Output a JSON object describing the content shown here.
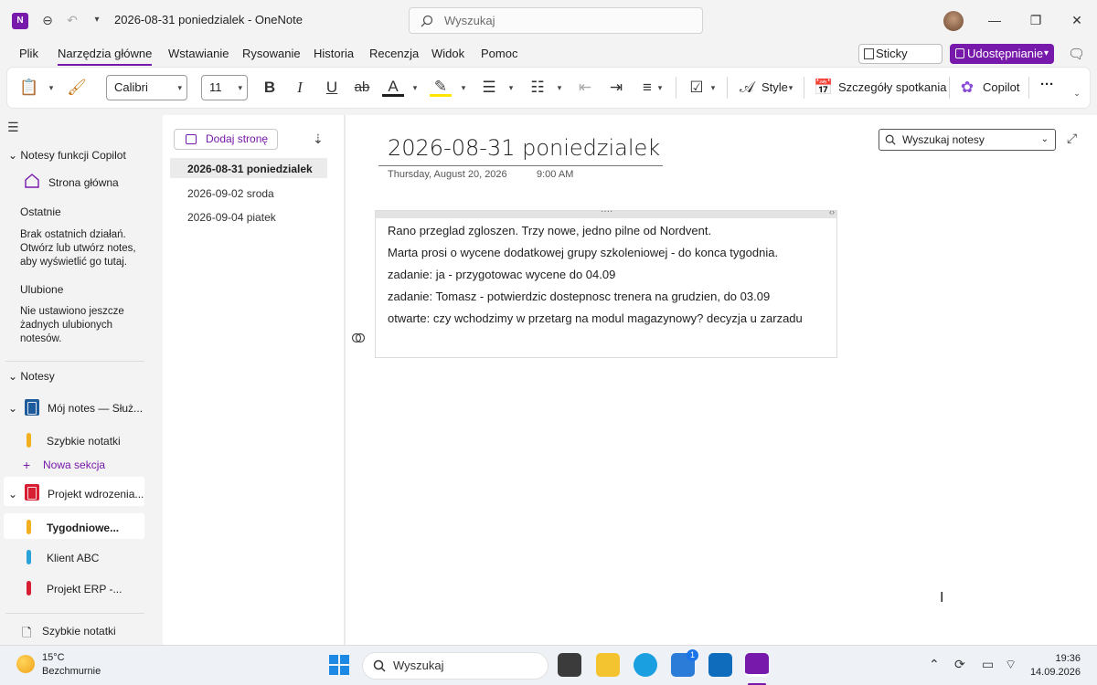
{
  "titlebar": {
    "app_icon": "onenote-icon",
    "doc_title": "2026-08-31 poniedzialek  -  OneNote",
    "search_placeholder": "Wyszukaj"
  },
  "menu": {
    "items": [
      "Plik",
      "Narzędzia główne",
      "Wstawianie",
      "Rysowanie",
      "Historia",
      "Recenzja",
      "Widok",
      "Pomoc"
    ],
    "active": "Narzędzia główne",
    "sticky_notes": "Sticky Notes",
    "share": "Udostępnianie"
  },
  "ribbon": {
    "font_name": "Calibri",
    "font_size": "11",
    "bold": "B",
    "italic": "I",
    "underline": "U",
    "strike": "ab",
    "font_color_letter": "A",
    "style": "Style",
    "meeting_details": "Szczegóły spotkania",
    "copilot": "Copilot",
    "more": "···",
    "colors": {
      "font_color": "#1f1f1f",
      "highlight": "#ffe600",
      "accent": "#7719aa"
    }
  },
  "left_nav": {
    "copilot_notebooks": "Notesy funkcji Copilot",
    "home": "Strona główna",
    "recent_heading": "Ostatnie",
    "recent_empty": "Brak ostatnich działań. Otwórz lub utwórz notes, aby wyświetlić go tutaj.",
    "favorites_heading": "Ulubione",
    "favorites_empty": "Nie ustawiono jeszcze żadnych ulubionych notesów.",
    "notebooks_heading": "Notesy",
    "notebooks": [
      {
        "name": "Mój notes — Służ...",
        "color": "#1e5b9c",
        "sections": [
          {
            "name": "Szybkie notatki",
            "color": "#f2b01e"
          }
        ],
        "add_section": "Nowa sekcja"
      },
      {
        "name": "Projekt wdrozenia...",
        "color": "#d81e33",
        "sections": [
          {
            "name": "Tygodniowe...",
            "color": "#f2b01e",
            "selected": true
          },
          {
            "name": "Klient ABC",
            "color": "#2aa3d8"
          },
          {
            "name": "Projekt ERP -...",
            "color": "#d81e33"
          }
        ]
      }
    ],
    "quick_notes": "Szybkie notatki"
  },
  "pages": {
    "add_page": "Dodaj stronę",
    "items": [
      "2026-08-31 poniedzialek",
      "2026-09-02 sroda",
      "2026-09-04 piatek"
    ],
    "selected": "2026-08-31 poniedzialek"
  },
  "page": {
    "title": "2026-08-31 poniedzialek",
    "date": "Thursday, August 20, 2026",
    "time": "9:00 AM",
    "note_lines": [
      "Rano przeglad zgloszen. Trzy nowe, jedno pilne od Nordvent.",
      "Marta prosi o wycene dodatkowej grupy szkoleniowej - do konca tygodnia.",
      "zadanie: ja - przygotowac wycene do 04.09",
      "zadanie: Tomasz - potwierdzic dostepnosc trenera na grudzien, do 03.09",
      "otwarte: czy wchodzimy w przetarg na modul magazynowy? decyzja u zarzadu"
    ],
    "search_notebooks": "Wyszukaj notesy"
  },
  "taskbar": {
    "weather_temp": "15°C",
    "weather_desc": "Bezchmurnie",
    "search": "Wyszukaj",
    "store_badge": "1",
    "time": "19:36",
    "date": "14.09.2026"
  }
}
